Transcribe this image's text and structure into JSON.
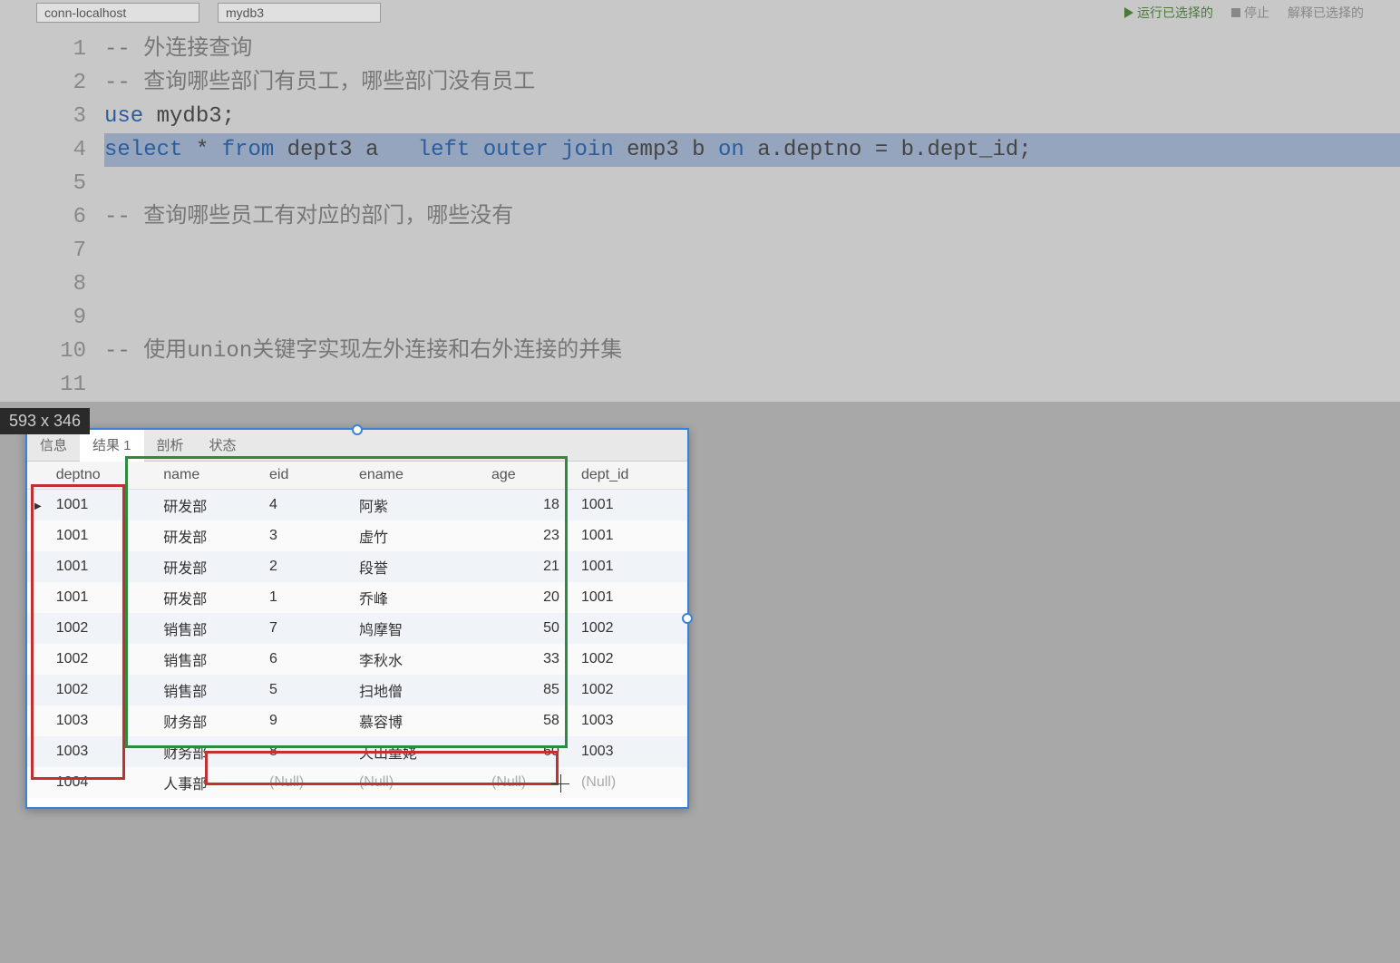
{
  "toolbar": {
    "connection": "conn-localhost",
    "database": "mydb3",
    "run_label": "运行已选择的",
    "stop_label": "停止",
    "explain_label": "解释已选择的"
  },
  "editor": {
    "lines": [
      {
        "num": "1",
        "type": "comment",
        "text": "-- 外连接查询"
      },
      {
        "num": "2",
        "type": "comment",
        "text": "-- 查询哪些部门有员工，哪些部门没有员工"
      },
      {
        "num": "3",
        "type": "code",
        "tokens": [
          [
            "kw",
            "use"
          ],
          [
            "sp",
            " "
          ],
          [
            "ident",
            "mydb3"
          ],
          [
            "op",
            ";"
          ]
        ]
      },
      {
        "num": "4",
        "type": "code",
        "highlighted": true,
        "tokens": [
          [
            "kw",
            "select"
          ],
          [
            "sp",
            " "
          ],
          [
            "op",
            "*"
          ],
          [
            "sp",
            " "
          ],
          [
            "kw",
            "from"
          ],
          [
            "sp",
            " "
          ],
          [
            "ident",
            "dept3 a"
          ],
          [
            "sp",
            "   "
          ],
          [
            "kw",
            "left outer join"
          ],
          [
            "sp",
            " "
          ],
          [
            "ident",
            "emp3 b"
          ],
          [
            "sp",
            " "
          ],
          [
            "kw",
            "on"
          ],
          [
            "sp",
            " "
          ],
          [
            "ident",
            "a.deptno"
          ],
          [
            "sp",
            " "
          ],
          [
            "op",
            "="
          ],
          [
            "sp",
            " "
          ],
          [
            "ident",
            "b.dept_id"
          ],
          [
            "op",
            ";"
          ]
        ]
      },
      {
        "num": "5",
        "type": "blank"
      },
      {
        "num": "6",
        "type": "comment",
        "text": "-- 查询哪些员工有对应的部门，哪些没有"
      },
      {
        "num": "7",
        "type": "blank"
      },
      {
        "num": "8",
        "type": "blank"
      },
      {
        "num": "9",
        "type": "blank"
      },
      {
        "num": "10",
        "type": "comment",
        "text": "-- 使用union关键字实现左外连接和右外连接的并集"
      },
      {
        "num": "11",
        "type": "blank"
      }
    ]
  },
  "selection_badge": "593 x 346",
  "tabs": {
    "info": "信息",
    "result": "结果 1",
    "profile": "剖析",
    "status": "状态"
  },
  "table": {
    "columns": [
      "deptno",
      "name",
      "eid",
      "ename",
      "age",
      "dept_id"
    ],
    "rows": [
      {
        "active": true,
        "deptno": "1001",
        "name": "研发部",
        "eid": "4",
        "ename": "阿紫",
        "age": "18",
        "dept_id": "1001"
      },
      {
        "active": false,
        "deptno": "1001",
        "name": "研发部",
        "eid": "3",
        "ename": "虚竹",
        "age": "23",
        "dept_id": "1001"
      },
      {
        "active": false,
        "deptno": "1001",
        "name": "研发部",
        "eid": "2",
        "ename": "段誉",
        "age": "21",
        "dept_id": "1001"
      },
      {
        "active": false,
        "deptno": "1001",
        "name": "研发部",
        "eid": "1",
        "ename": "乔峰",
        "age": "20",
        "dept_id": "1001"
      },
      {
        "active": false,
        "deptno": "1002",
        "name": "销售部",
        "eid": "7",
        "ename": "鸠摩智",
        "age": "50",
        "dept_id": "1002"
      },
      {
        "active": false,
        "deptno": "1002",
        "name": "销售部",
        "eid": "6",
        "ename": "李秋水",
        "age": "33",
        "dept_id": "1002"
      },
      {
        "active": false,
        "deptno": "1002",
        "name": "销售部",
        "eid": "5",
        "ename": "扫地僧",
        "age": "85",
        "dept_id": "1002"
      },
      {
        "active": false,
        "deptno": "1003",
        "name": "财务部",
        "eid": "9",
        "ename": "慕容博",
        "age": "58",
        "dept_id": "1003"
      },
      {
        "active": false,
        "deptno": "1003",
        "name": "财务部",
        "eid": "8",
        "ename": "天山童姥",
        "age": "60",
        "dept_id": "1003"
      },
      {
        "active": false,
        "deptno": "1004",
        "name": "人事部",
        "eid": "(Null)",
        "ename": "(Null)",
        "age": "(Null)",
        "dept_id": "(Null)",
        "nulls": true
      }
    ]
  }
}
